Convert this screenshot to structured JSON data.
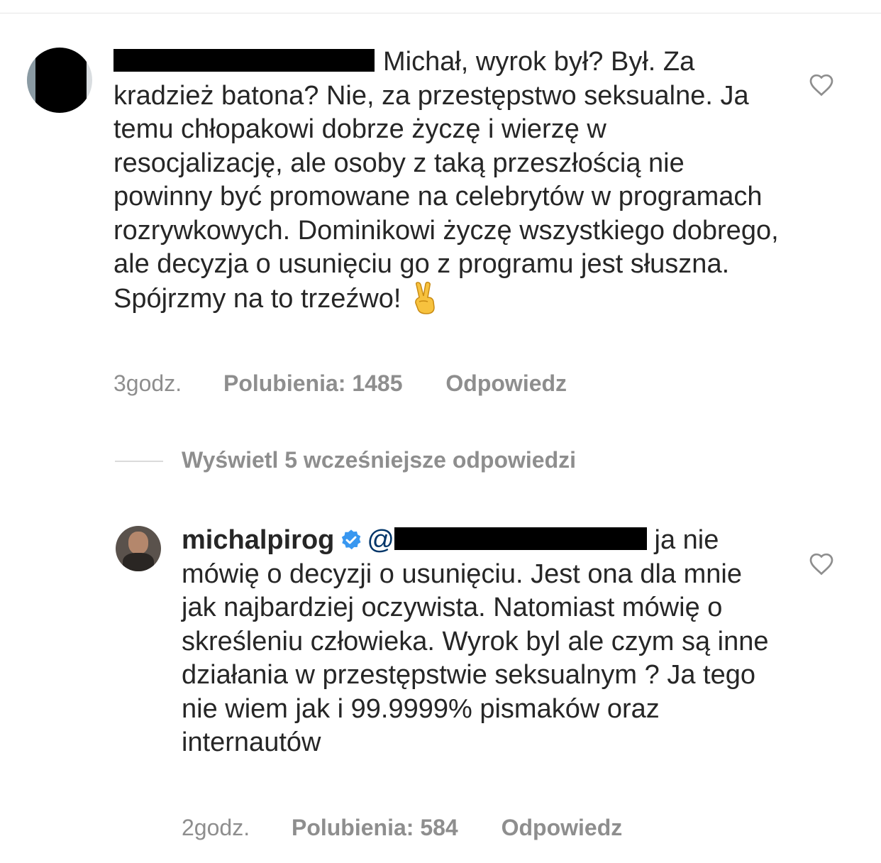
{
  "comments": [
    {
      "username": "",
      "text": "Michał, wyrok był? Był. Za kradzież batona? Nie, za przestępstwo seksualne. Ja temu chłopakowi dobrze życzę i wierzę w resocjalizację, ale osoby z taką przeszłością nie powinny być promowane na celebrytów w programach rozrywkowych. Dominikowi życzę wszystkiego dobrego, ale decyzja o usunięciu go z programu jest słuszna. Spójrzmy na to trzeźwo!",
      "emoji": "victory-hand-emoji",
      "time": "3godz.",
      "likes": "Polubienia: 1485",
      "reply": "Odpowiedz"
    },
    {
      "username": "michalpirog",
      "verified": true,
      "mention_prefix": "@",
      "text": "ja nie mówię o decyzji o usunięciu. Jest ona dla mnie jak najbardziej oczywista. Natomiast mówię o skreśleniu człowieka. Wyrok byl ale czym są inne działania w przestępstwie seksualnym ? Ja tego nie wiem jak i 99.9999% pismaków oraz internautów",
      "time": "2godz.",
      "likes": "Polubienia: 584",
      "reply": "Odpowiedz"
    }
  ],
  "view_replies": {
    "label": "Wyświetl 5 wcześniejsze odpowiedzi"
  },
  "colors": {
    "text": "#262626",
    "meta": "#8e8e8e",
    "verified": "#3897f0",
    "mention": "#003569",
    "divider": "#dbdbdb"
  },
  "icons": {
    "like": "heart-outline-icon",
    "verified": "verified-badge-icon"
  }
}
